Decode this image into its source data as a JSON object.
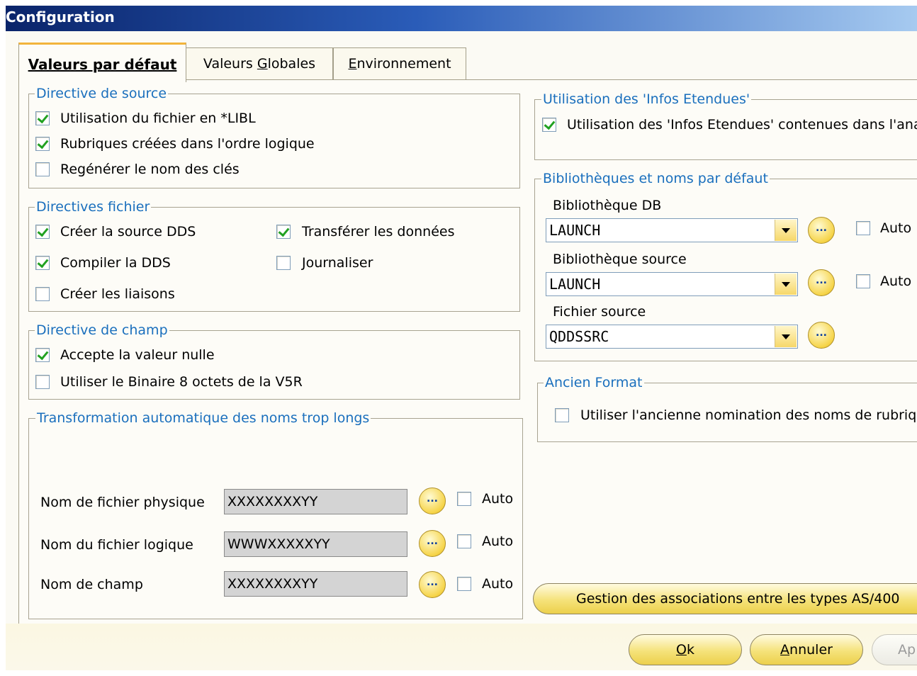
{
  "window": {
    "title": "Configuration"
  },
  "tabs": [
    {
      "label": "Valeurs par défaut",
      "active": true
    },
    {
      "pre": "Valeurs ",
      "mn": "G",
      "post": "lobales"
    },
    {
      "pre": "",
      "mn": "E",
      "post": "nvironnement"
    }
  ],
  "directive_source": {
    "title": "Directive de source",
    "items": [
      {
        "label": "Utilisation du fichier en *LIBL",
        "checked": true
      },
      {
        "label": "Rubriques créées dans l'ordre logique",
        "checked": true
      },
      {
        "label": "Regénérer le nom des clés",
        "checked": false
      }
    ]
  },
  "directives_fichier": {
    "title": "Directives fichier",
    "items": [
      {
        "label": "Créer la source DDS",
        "checked": true
      },
      {
        "label": "Transférer les données",
        "checked": true
      },
      {
        "label": "Compiler la DDS",
        "checked": true
      },
      {
        "label": "Journaliser",
        "checked": false
      },
      {
        "label": "Créer les liaisons",
        "checked": false
      }
    ]
  },
  "directive_champ": {
    "title": "Directive de champ",
    "items": [
      {
        "label": "Accepte la valeur nulle",
        "checked": true
      },
      {
        "label": "Utiliser le Binaire 8 octets de la V5R",
        "checked": false
      }
    ]
  },
  "transformation": {
    "title": "Transformation automatique des noms trop longs",
    "rows": [
      {
        "label": "Nom de fichier physique",
        "value": "XXXXXXXXYY",
        "auto_label": "Auto",
        "auto": false
      },
      {
        "label": "Nom du fichier logique",
        "value": "WWWXXXXXYY",
        "auto_label": "Auto",
        "auto": false
      },
      {
        "label": "Nom de champ",
        "value": "XXXXXXXXYY",
        "auto_label": "Auto",
        "auto": false
      }
    ],
    "ellipsis": "..."
  },
  "infos_etendues": {
    "title": "Utilisation des 'Infos Etendues'",
    "item": {
      "label": "Utilisation des 'Infos Etendues' contenues dans l'ana",
      "checked": true
    }
  },
  "bibliotheques": {
    "title": "Bibliothèques et noms par défaut",
    "db_label": "Bibliothèque DB",
    "db_value": "LAUNCH",
    "src_label": "Bibliothèque source",
    "src_value": "LAUNCH",
    "file_label": "Fichier source",
    "file_value": "QDDSSRC",
    "auto_label": "Auto"
  },
  "ancien_format": {
    "title": "Ancien Format",
    "item": {
      "label": "Utiliser l'ancienne nomination des noms de rubrique",
      "checked": false
    }
  },
  "gestion_button": "Gestion des associations entre les types AS/400",
  "buttons": {
    "ok": {
      "mn": "O",
      "rest": "k"
    },
    "cancel": {
      "mn": "A",
      "rest": "nnuler"
    },
    "apply": "Ap"
  },
  "colors": {
    "accent": "#f2b43c",
    "group_title": "#1a6fbd",
    "title_bar": "#0a246a",
    "button": "#f5e27a"
  }
}
